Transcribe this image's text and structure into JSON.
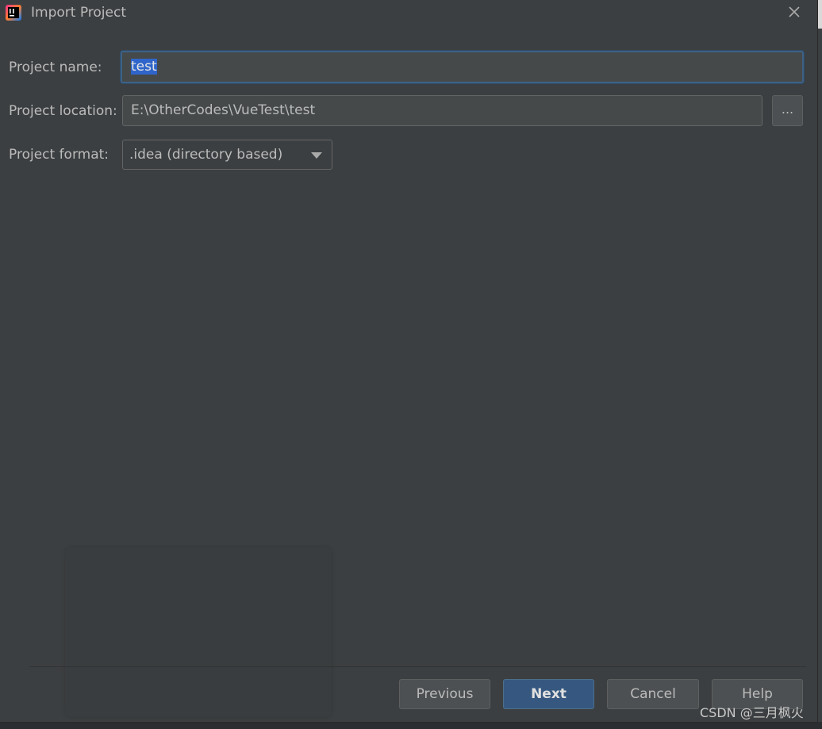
{
  "window": {
    "title": "Import Project",
    "app_icon": "intellij-icon",
    "close_icon": "close-icon"
  },
  "form": {
    "project_name": {
      "label": "Project name:",
      "value": "test"
    },
    "project_location": {
      "label": "Project location:",
      "value": "E:\\OtherCodes\\VueTest\\test",
      "browse_label": "..."
    },
    "project_format": {
      "label": "Project format:",
      "selected": ".idea (directory based)"
    }
  },
  "footer": {
    "previous_label": "Previous",
    "next_label": "Next",
    "cancel_label": "Cancel",
    "help_label": "Help"
  },
  "watermark": "CSDN @三月枫火",
  "colors": {
    "background": "#3c3f41",
    "field_bg": "#45494a",
    "focus_border": "#3d6185",
    "selection": "#2f65ca",
    "primary_button": "#365880"
  }
}
